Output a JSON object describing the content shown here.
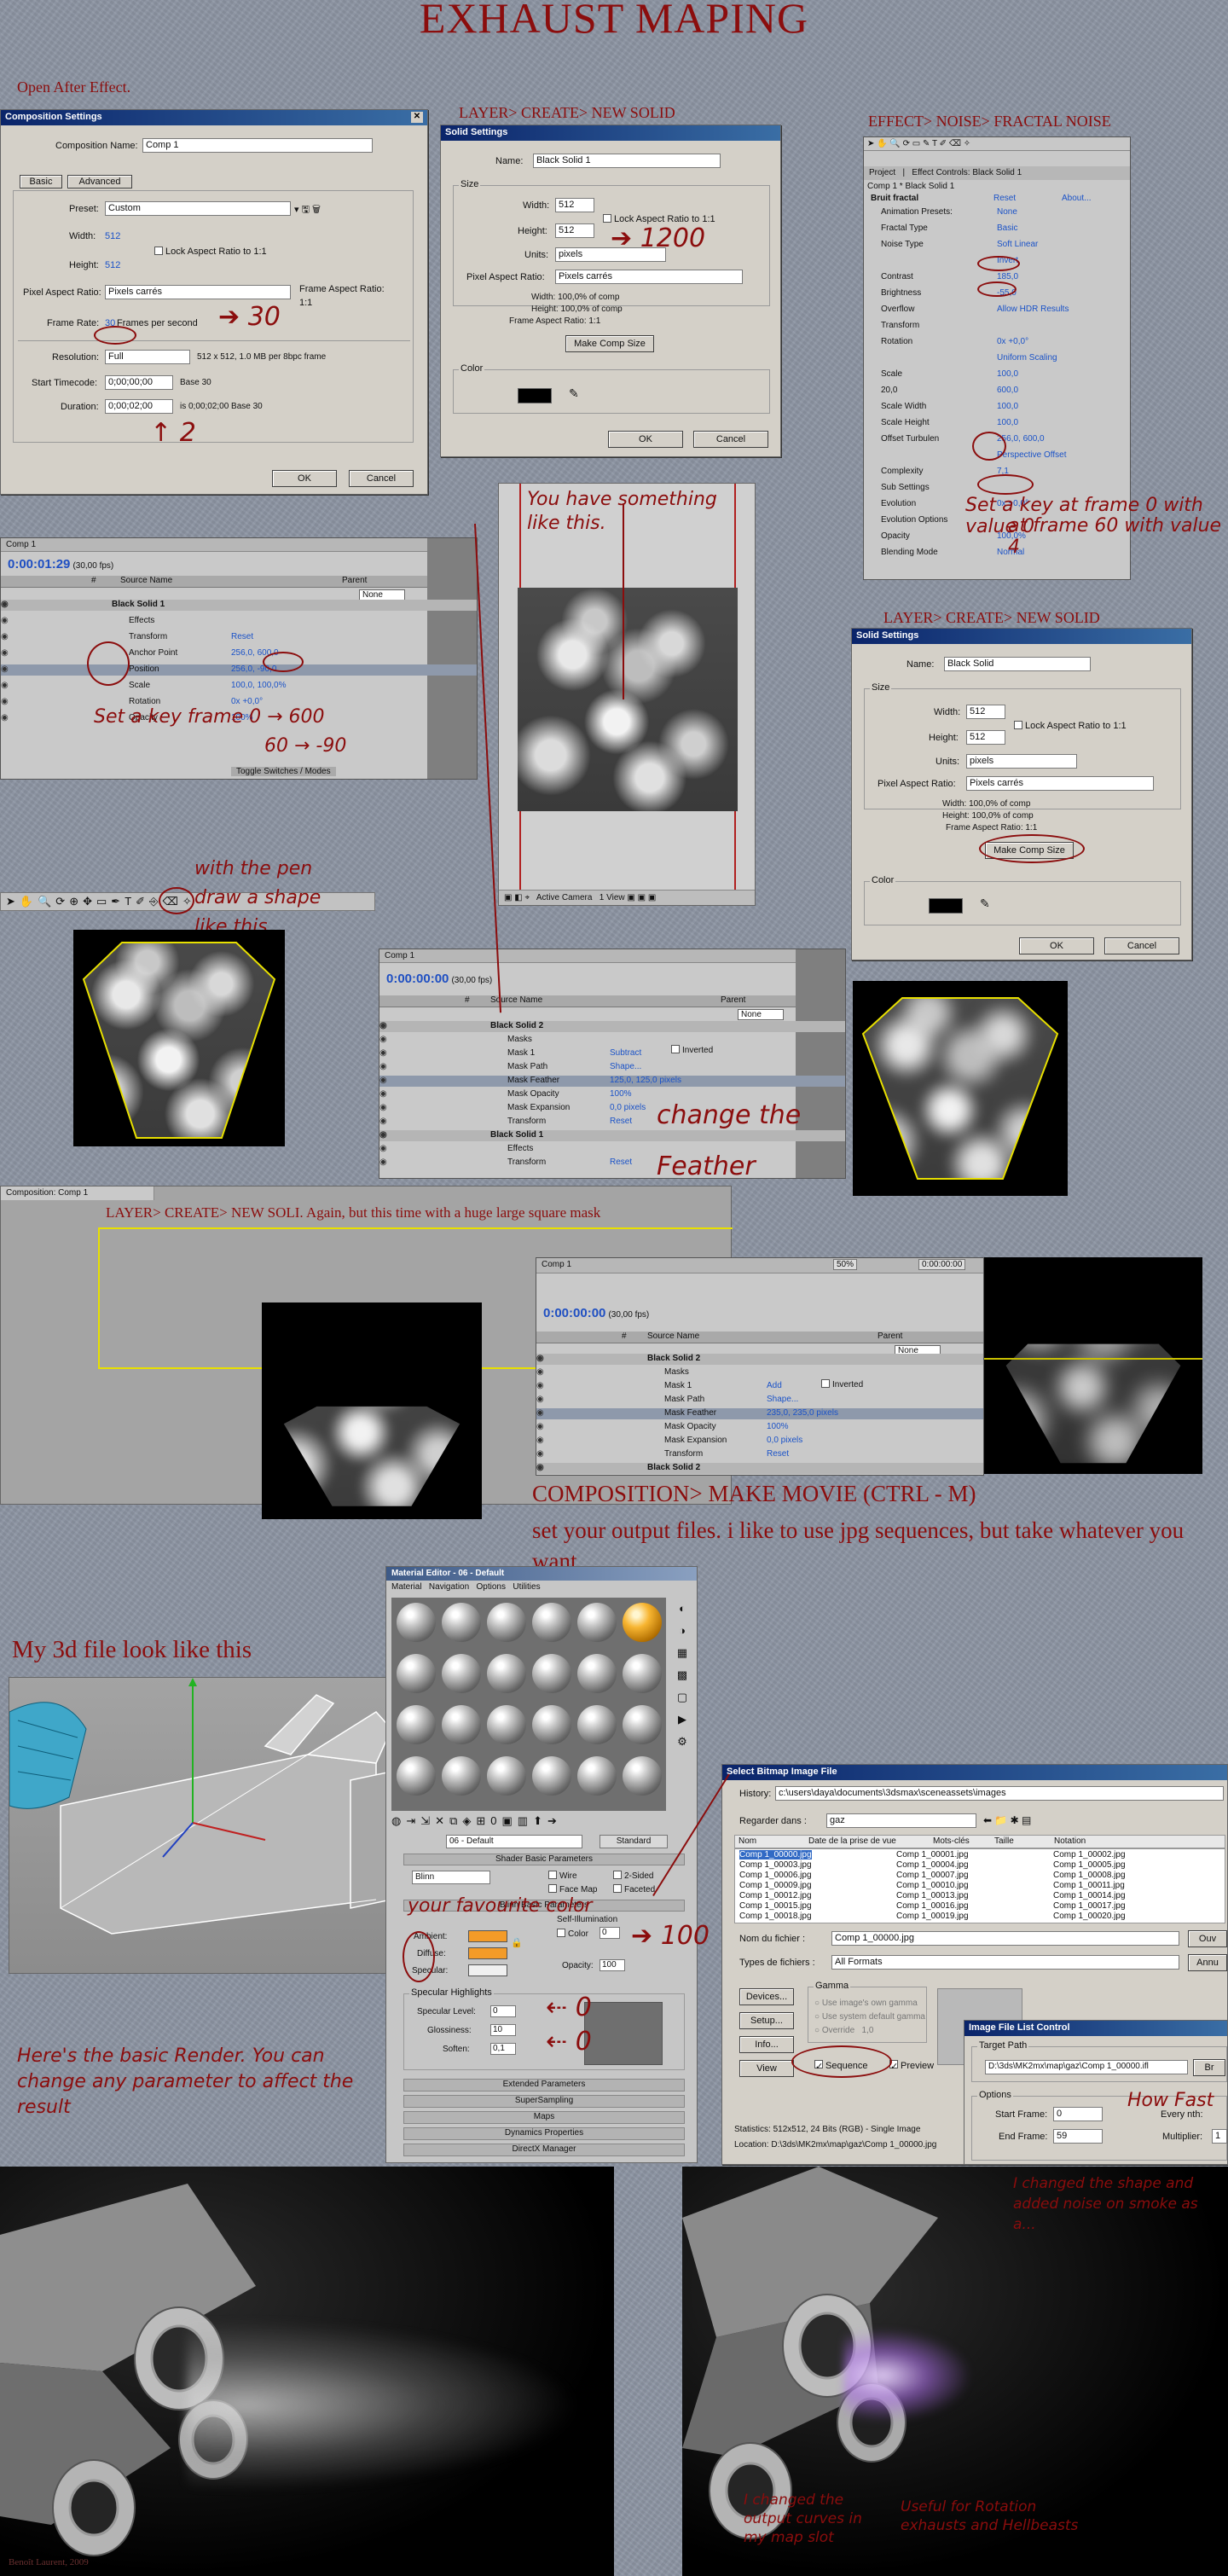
{
  "title": "EXHAUST MAPING",
  "notes": {
    "open_ae": "Open After Effect.",
    "layer_create_solid_1": "LAYER>   CREATE>   NEW   SOLID",
    "effect_fractal": "EFFECT> NOISE> FRACTAL NOISE",
    "layer_create_solid_2": "LAYER>   CREATE>   NEW   SOLID",
    "hand_1200": "1200",
    "hand_30": "30",
    "hand_2": "2",
    "hand_you_have": "You have something like this.",
    "hand_set_key_frac": "Set a key at frame 0 with value 0",
    "hand_set_key_frac2": "at frame 60 with value 4",
    "hand_set_key_pos": "Set a key frame 0 → 600",
    "hand_set_key_pos2": "60 → -90",
    "hand_pen": "with the pen draw a shape like this",
    "hand_feather": "change the Feather",
    "layer_huge_mask": "LAYER> CREATE> NEW SOLI. Again, but this time with a huge large square mask",
    "make_movie": "COMPOSITION> MAKE MOVIE (CTRL - M)",
    "output_files": "set your output files. i like to use jpg sequences, but take whatever you want.",
    "my_3d": "My 3d file look like this",
    "hand_color": "your favourite color",
    "hand_100": "100",
    "hand_0a": "0",
    "hand_0b": "0",
    "hand_render": "Here's the basic Render. You can change any parameter to affect the result",
    "hand_howfast": "How Fast",
    "hand_shape": "I changed the shape and added noise on smoke as a...",
    "hand_curves": "I changed the output curves in my map slot",
    "hand_useful": "Useful for Rotation exhausts and Hellbeasts",
    "credit": "Benoît Laurent, 2009"
  },
  "comp_settings": {
    "title": "Composition Settings",
    "name_label": "Composition Name:",
    "name_value": "Comp 1",
    "tab_basic": "Basic",
    "tab_advanced": "Advanced",
    "preset_label": "Preset:",
    "preset_value": "Custom",
    "width_label": "Width:",
    "width_value": "512",
    "height_label": "Height:",
    "height_value": "512",
    "lock_label": "Lock Aspect Ratio to 1:1",
    "par_label": "Pixel Aspect Ratio:",
    "par_value": "Pixels carrés",
    "far_label": "Frame Aspect Ratio:",
    "far_value": "1:1",
    "fps_label": "Frame Rate:",
    "fps_value": "30",
    "fps_unit": "Frames per second",
    "res_label": "Resolution:",
    "res_value": "Full",
    "res_info": "512 x 512, 1.0 MB per 8bpc frame",
    "start_label": "Start Timecode:",
    "start_value": "0;00;00;00",
    "start_base": "Base 30",
    "dur_label": "Duration:",
    "dur_value": "0;00;02;00",
    "dur_info": "is 0;00;02;00  Base 30",
    "ok": "OK",
    "cancel": "Cancel"
  },
  "solid_1": {
    "title": "Solid Settings",
    "name_label": "Name:",
    "name_value": "Black Solid 1",
    "size_group": "Size",
    "width_label": "Width:",
    "width_value": "512",
    "height_label": "Height:",
    "height_value": "512",
    "lock_label": "Lock Aspect Ratio to 1:1",
    "units_label": "Units:",
    "units_value": "pixels",
    "par_label": "Pixel Aspect Ratio:",
    "par_value": "Pixels carrés",
    "info_w": "Width:   100,0% of comp",
    "info_h": "Height:   100,0% of comp",
    "info_far": "Frame Aspect Ratio: 1:1",
    "make_comp": "Make Comp Size",
    "color_group": "Color",
    "ok": "OK",
    "cancel": "Cancel"
  },
  "solid_2": {
    "title": "Solid Settings",
    "name_label": "Name:",
    "name_value": "Black Solid",
    "size_group": "Size",
    "width_label": "Width:",
    "width_value": "512",
    "height_label": "Height:",
    "height_value": "512",
    "lock_label": "Lock Aspect Ratio to 1:1",
    "units_label": "Units:",
    "units_value": "pixels",
    "par_label": "Pixel Aspect Ratio:",
    "par_value": "Pixels carrés",
    "info_w": "Width:   100,0% of comp",
    "info_h": "Height:   100,0% of comp",
    "info_far": "Frame Aspect Ratio: 1:1",
    "make_comp": "Make Comp Size",
    "color_group": "Color",
    "ok": "OK",
    "cancel": "Cancel"
  },
  "fractal": {
    "tab_project": "Project",
    "tab_effect": "Effect Controls: Black Solid 1",
    "layer": "Comp 1 * Black Solid 1",
    "effect_name": "Bruit fractal",
    "reset": "Reset",
    "about": "About...",
    "rows": [
      {
        "label": "Animation Presets:",
        "value": "None"
      },
      {
        "label": "Fractal Type",
        "value": "Basic"
      },
      {
        "label": "Noise Type",
        "value": "Soft Linear"
      },
      {
        "label": "",
        "value": "Invert"
      },
      {
        "label": "Contrast",
        "value": "185,0"
      },
      {
        "label": "Brightness",
        "value": "-55,0"
      },
      {
        "label": "Overflow",
        "value": "Allow HDR Results"
      },
      {
        "label": "Transform",
        "value": ""
      },
      {
        "label": "Rotation",
        "value": "0x +0,0°"
      },
      {
        "label": "",
        "value": "Uniform Scaling"
      },
      {
        "label": "Scale",
        "value": "100,0"
      },
      {
        "label": "20,0",
        "value": "600,0"
      },
      {
        "label": "Scale Width",
        "value": "100,0"
      },
      {
        "label": "Scale Height",
        "value": "100,0"
      },
      {
        "label": "Offset Turbulen",
        "value": "256,0, 600,0"
      },
      {
        "label": "",
        "value": "Perspective Offset"
      },
      {
        "label": "Complexity",
        "value": "7,1"
      },
      {
        "label": "Sub Settings",
        "value": ""
      },
      {
        "label": "Evolution",
        "value": "0x +0,0°"
      },
      {
        "label": "Evolution Options",
        "value": ""
      },
      {
        "label": "Opacity",
        "value": "100,0%"
      },
      {
        "label": "Blending Mode",
        "value": "Normal"
      }
    ]
  },
  "timeline_1": {
    "tab": "Comp 1",
    "time": "0:00:01:29",
    "fps": "(30,00 fps)",
    "col_num": "#",
    "col_source": "Source Name",
    "col_parent": "Parent",
    "parent_value": "None",
    "rows": [
      {
        "label": "Black Solid 1",
        "value": ""
      },
      {
        "label": "Effects",
        "value": ""
      },
      {
        "label": "Transform",
        "value": "Reset"
      },
      {
        "label": "Anchor Point",
        "value": "256,0, 600,0"
      },
      {
        "label": "Position",
        "value": "256,0, -90,0"
      },
      {
        "label": "Scale",
        "value": "100,0, 100,0%"
      },
      {
        "label": "Rotation",
        "value": "0x +0,0°"
      },
      {
        "label": "Opacity",
        "value": "100%"
      }
    ],
    "footer": "Toggle Switches / Modes"
  },
  "viewer_1": {
    "footer_cam": "Active Camera",
    "footer_view": "1 View"
  },
  "timeline_2": {
    "tab": "Comp 1",
    "time": "0:00:00:00",
    "fps": "(30,00 fps)",
    "col_num": "#",
    "col_source": "Source Name",
    "col_parent": "Parent",
    "parent_value": "None",
    "rows": [
      {
        "label": "Black Solid 2",
        "value": ""
      },
      {
        "label": "Masks",
        "value": ""
      },
      {
        "label": "Mask 1",
        "value": "Subtract"
      },
      {
        "label": "Mask Path",
        "value": "Shape..."
      },
      {
        "label": "Mask Feather",
        "value": "125,0, 125,0 pixels"
      },
      {
        "label": "Mask Opacity",
        "value": "100%"
      },
      {
        "label": "Mask Expansion",
        "value": "0,0 pixels"
      },
      {
        "label": "Transform",
        "value": "Reset"
      },
      {
        "label": "Black Solid 1",
        "value": ""
      },
      {
        "label": "Effects",
        "value": ""
      },
      {
        "label": "Transform",
        "value": "Reset"
      }
    ],
    "inverted": "Inverted"
  },
  "huge_mask_window": {
    "tab": "Composition: Comp 1"
  },
  "timeline_3": {
    "tab": "Comp 1",
    "zoom": "50%",
    "timecode": "0:00:00:00",
    "time": "0:00:00:00",
    "fps": "(30,00 fps)",
    "col_num": "#",
    "col_source": "Source Name",
    "col_parent": "Parent",
    "parent_value": "None",
    "rows": [
      {
        "label": "Black Solid 2",
        "value": ""
      },
      {
        "label": "Masks",
        "value": ""
      },
      {
        "label": "Mask 1",
        "value": "Add"
      },
      {
        "label": "Mask Path",
        "value": "Shape..."
      },
      {
        "label": "Mask Feather",
        "value": "235,0, 235,0 pixels"
      },
      {
        "label": "Mask Opacity",
        "value": "100%"
      },
      {
        "label": "Mask Expansion",
        "value": "0,0 pixels"
      },
      {
        "label": "Transform",
        "value": "Reset"
      },
      {
        "label": "Black Solid 2",
        "value": ""
      }
    ],
    "inverted": "Inverted"
  },
  "material_editor": {
    "title": "Material Editor - 06 - Default",
    "menu": [
      "Material",
      "Navigation",
      "Options",
      "Utilities"
    ],
    "mat_name": "06 - Default",
    "mat_type": "Standard",
    "shader_basic": "Shader Basic Parameters",
    "shader_type": "Blinn",
    "wire": "Wire",
    "two_sided": "2-Sided",
    "face_map": "Face Map",
    "faceted": "Faceted",
    "blinn_basic": "Blinn Basic Parameters",
    "self_illum": "Self-Illumination",
    "color_label": "Color",
    "color_value": "0",
    "ambient": "Ambient:",
    "diffuse": "Diffuse:",
    "specular": "Specular:",
    "opacity_label": "Opacity:",
    "opacity_value": "100",
    "spec_highlights": "Specular Highlights",
    "spec_level": "Specular Level:",
    "spec_level_value": "0",
    "glossiness": "Glossiness:",
    "glossiness_value": "10",
    "soften": "Soften:",
    "soften_value": "0,1",
    "rollouts": [
      "Extended Parameters",
      "SuperSampling",
      "Maps",
      "Dynamics Properties",
      "DirectX Manager"
    ]
  },
  "bitmap_dialog": {
    "title": "Select Bitmap Image File",
    "history_label": "History:",
    "history_value": "c:\\users\\daya\\documents\\3dsmax\\sceneassets\\images",
    "lookin_label": "Regarder dans :",
    "lookin_value": "gaz",
    "cols": [
      "Nom",
      "Date de la prise de vue",
      "Mots-clés",
      "Taille",
      "Notation"
    ],
    "files": [
      "Comp 1_00000.jpg",
      "Comp 1_00001.jpg",
      "Comp 1_00002.jpg",
      "Comp 1_00003.jpg",
      "Comp 1_00004.jpg",
      "Comp 1_00005.jpg",
      "Comp 1_00006.jpg",
      "Comp 1_00007.jpg",
      "Comp 1_00008.jpg",
      "Comp 1_00009.jpg",
      "Comp 1_00010.jpg",
      "Comp 1_00011.jpg",
      "Comp 1_00012.jpg",
      "Comp 1_00013.jpg",
      "Comp 1_00014.jpg",
      "Comp 1_00015.jpg",
      "Comp 1_00016.jpg",
      "Comp 1_00017.jpg",
      "Comp 1_00018.jpg",
      "Comp 1_00019.jpg",
      "Comp 1_00020.jpg"
    ],
    "filename_label": "Nom du fichier :",
    "filename_value": "Comp 1_00000.jpg",
    "types_label": "Types de fichiers :",
    "types_value": "All Formats",
    "devices": "Devices...",
    "setup": "Setup...",
    "info": "Info...",
    "view": "View",
    "gamma": "Gamma",
    "gamma_own": "Use image's own gamma",
    "gamma_sys": "Use system default gamma",
    "gamma_override": "Override",
    "gamma_override_value": "1,0",
    "sequence": "Sequence",
    "preview": "Preview",
    "stats": "Statistics:  512x512, 24 Bits (RGB) - Single Image",
    "location": "Location:  D:\\3ds\\MK2mx\\map\\gaz\\Comp 1_00000.jpg",
    "open_short": "Ouv",
    "cancel_short": "Annu"
  },
  "ifl": {
    "title": "Image File List Control",
    "target_label": "Target Path",
    "target_value": "D:\\3ds\\MK2mx\\map\\gaz\\Comp 1_00000.ifl",
    "browse_short": "Br",
    "options": "Options",
    "start_label": "Start Frame:",
    "start_value": "0",
    "end_label": "End Frame:",
    "end_value": "59",
    "every_label": "Every nth:",
    "mult_label": "Multiplier:",
    "mult_value": "1"
  },
  "toolbar_icons": [
    "arrow-tool",
    "hand-tool",
    "zoom-tool",
    "rotate-tool",
    "orbit-tool",
    "pan-tool",
    "pen-tool",
    "text-tool",
    "brush-tool",
    "stamp-tool",
    "eraser-tool",
    "puppet-tool"
  ]
}
